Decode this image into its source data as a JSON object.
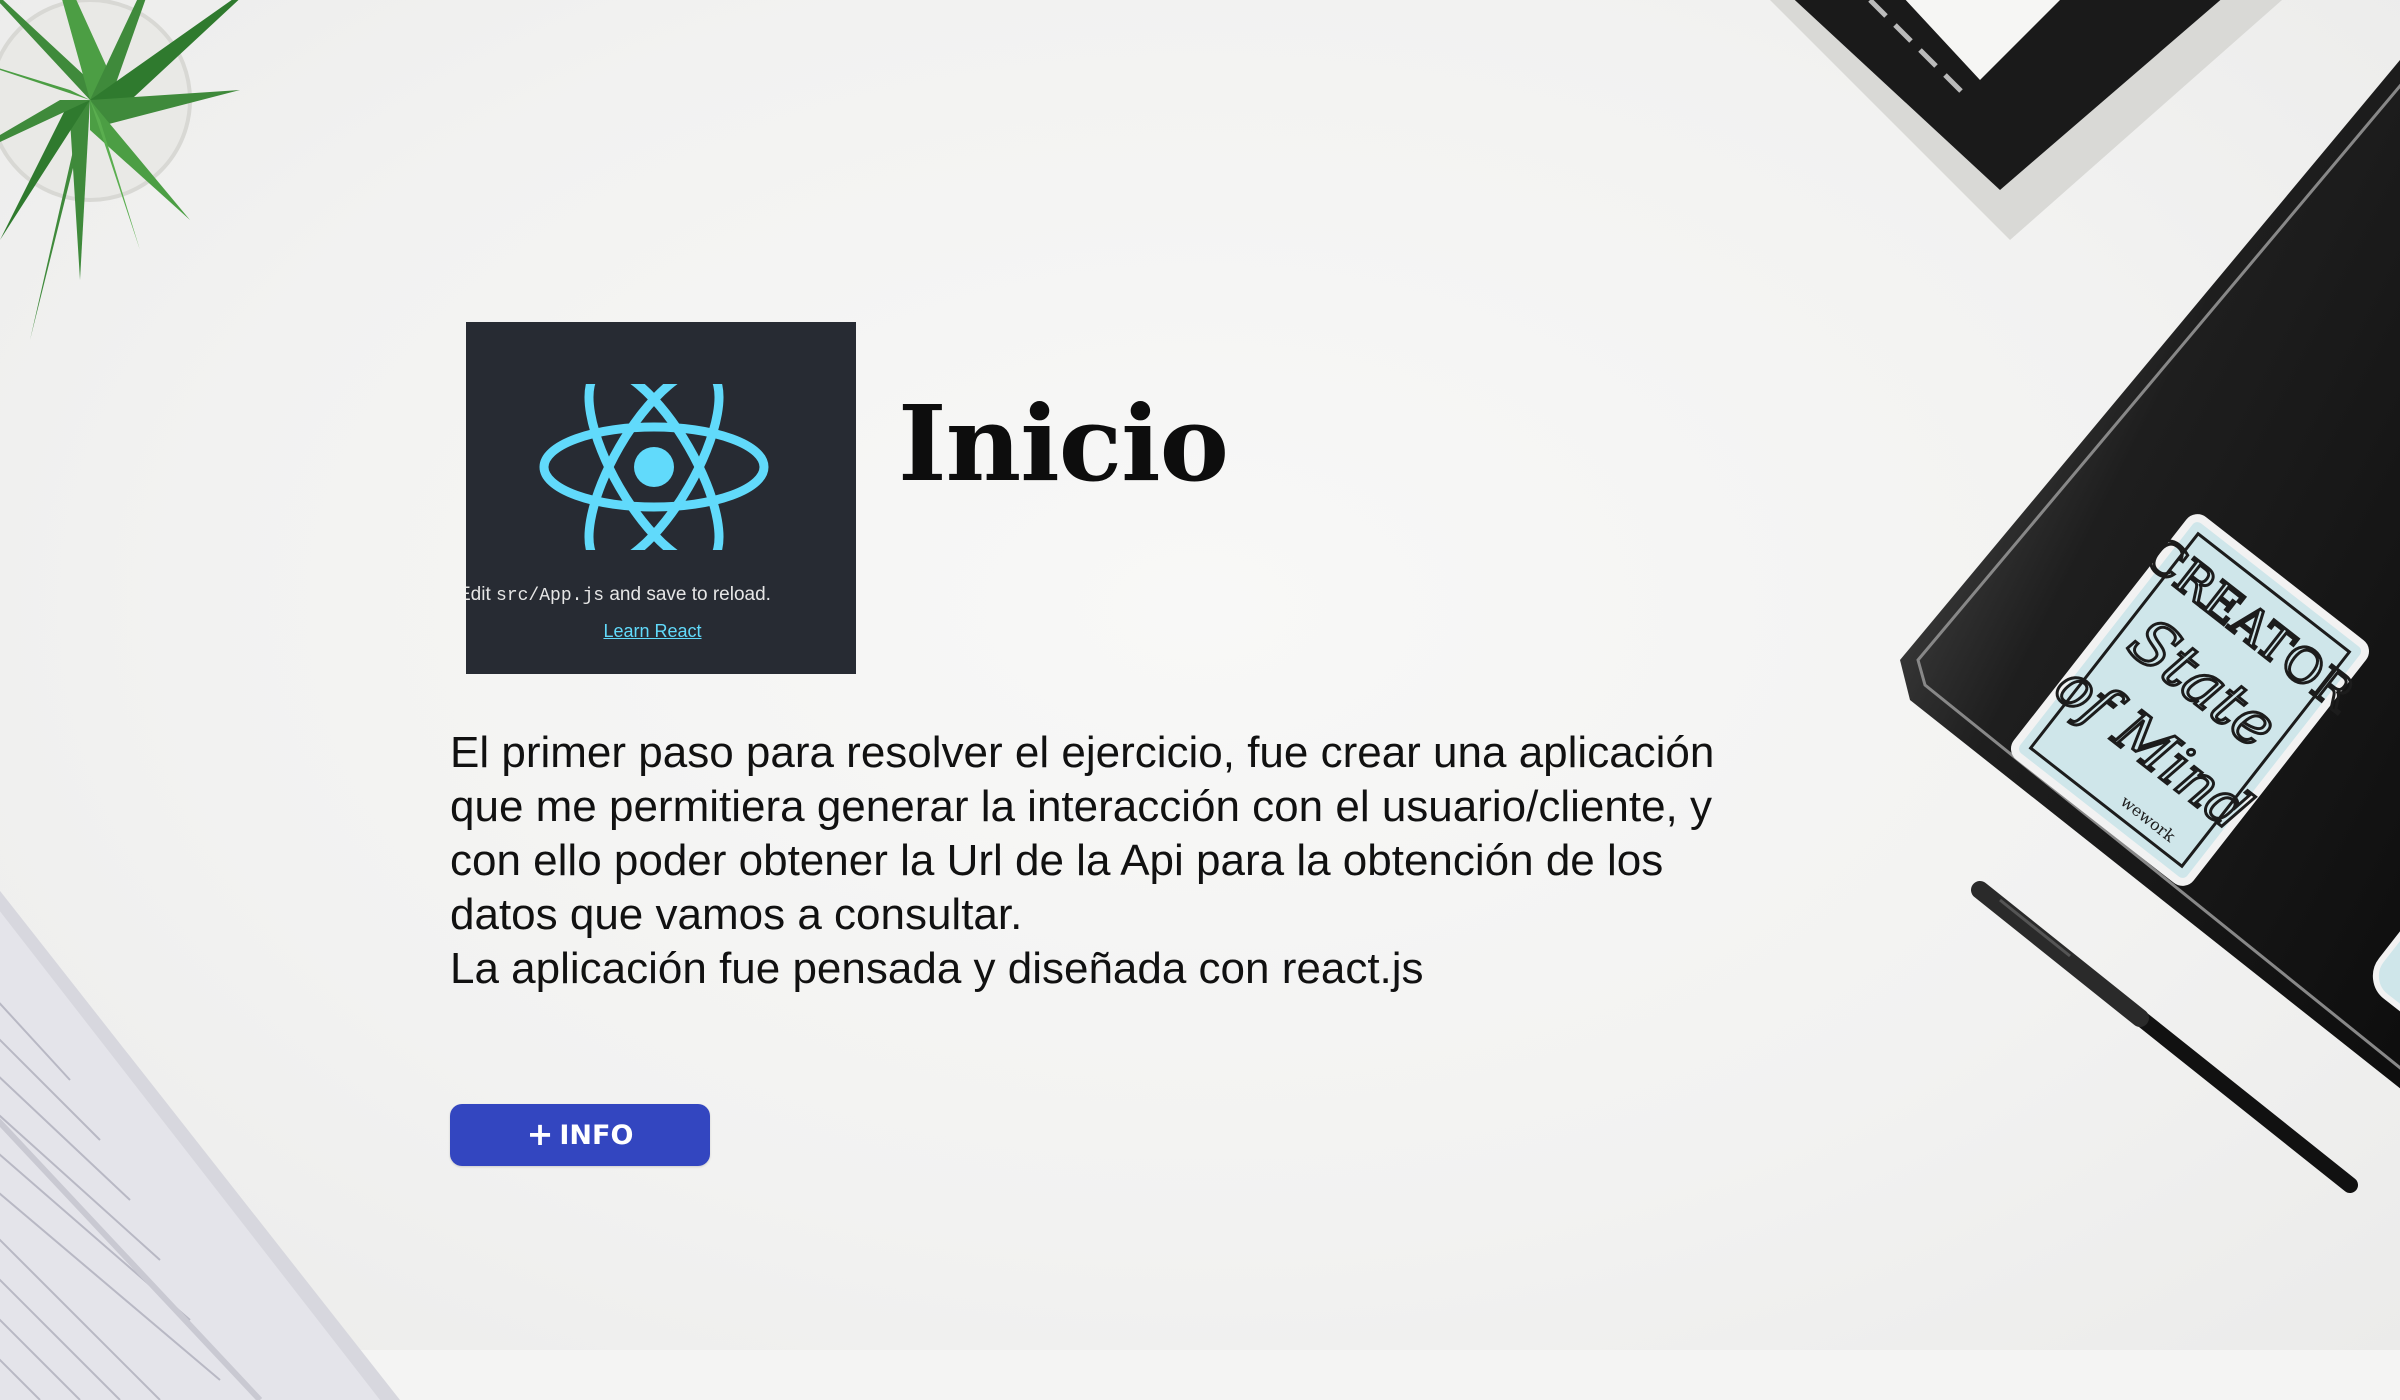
{
  "thumbnail": {
    "edit_prefix": "Edit ",
    "edit_code": "src/App.js",
    "edit_suffix": " and save to reload.",
    "link_text": "Learn React",
    "logo_icon": "react-logo-icon"
  },
  "page": {
    "title": "Inicio",
    "paragraph_lines": [
      "El primer paso para resolver el ejercicio, fue crear una aplicación",
      "que me permitiera generar la interacción con el usuario/cliente, y",
      "con ello poder obtener la Url de la Api para la obtención de los",
      "datos que vamos a consultar.",
      "La aplicación fue pensada y diseñada con react.js"
    ]
  },
  "button": {
    "icon": "+",
    "label": "INFO"
  },
  "decor": {
    "sticker_icon": "creator-sticker-icon",
    "sticker_text": "CREATOR State Of Mind",
    "sticker_brand": "wework"
  },
  "colors": {
    "button": "#3346c0",
    "react_blue": "#61dafb",
    "thumb_bg": "#272b33"
  }
}
